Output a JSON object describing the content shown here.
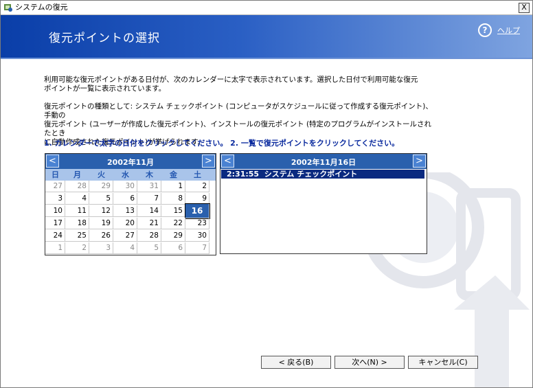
{
  "window": {
    "title": "システムの復元",
    "close_label": "X"
  },
  "header": {
    "title": "復元ポイントの選択",
    "help_label": "ヘルプ",
    "help_icon": "?"
  },
  "description": {
    "line1": "利用可能な復元ポイントがある日付が、次のカレンダーに太字で表示されています。選択した日付で利用可能な復元",
    "line2": "ポイントが一覧に表示されています。",
    "types1": "復元ポイントの種類として: システム チェックポイント (コンピュータがスケジュールに従って作成する復元ポイント)、手動の",
    "types2": "復元ポイント (ユーザーが作成した復元ポイント)、インストールの復元ポイント (特定のプログラムがインストールされたとき",
    "types3": "に自動作成された復元ポイント)が挙げられます。"
  },
  "instruction": "1. カレンダーで太字の日付をクリックしてください。 2. 一覧で復元ポイントをクリックしてください。",
  "calendar": {
    "prev": "<",
    "next": ">",
    "month_label": "2002年11月",
    "weekdays": [
      "日",
      "月",
      "火",
      "水",
      "木",
      "金",
      "土"
    ],
    "weeks": [
      [
        "27",
        "28",
        "29",
        "30",
        "31",
        "1",
        "2"
      ],
      [
        "3",
        "4",
        "5",
        "6",
        "7",
        "8",
        "9"
      ],
      [
        "10",
        "11",
        "12",
        "13",
        "14",
        "15",
        "16"
      ],
      [
        "17",
        "18",
        "19",
        "20",
        "21",
        "22",
        "23"
      ],
      [
        "24",
        "25",
        "26",
        "27",
        "28",
        "29",
        "30"
      ],
      [
        "1",
        "2",
        "3",
        "4",
        "5",
        "6",
        "7"
      ]
    ],
    "selected": "16"
  },
  "list": {
    "prev": "<",
    "next": ">",
    "date_label": "2002年11月16日",
    "items": [
      {
        "time": "2:31:55",
        "name": "システム チェックポイント"
      }
    ]
  },
  "buttons": {
    "back": "< 戻る(B)",
    "next": "次へ(N) >",
    "cancel": "キャンセル(C)"
  },
  "colors": {
    "header_start": "#0a3ea8",
    "header_end": "#7fa4e0",
    "accent": "#2a60ad",
    "instruction": "#0a2a9e"
  }
}
